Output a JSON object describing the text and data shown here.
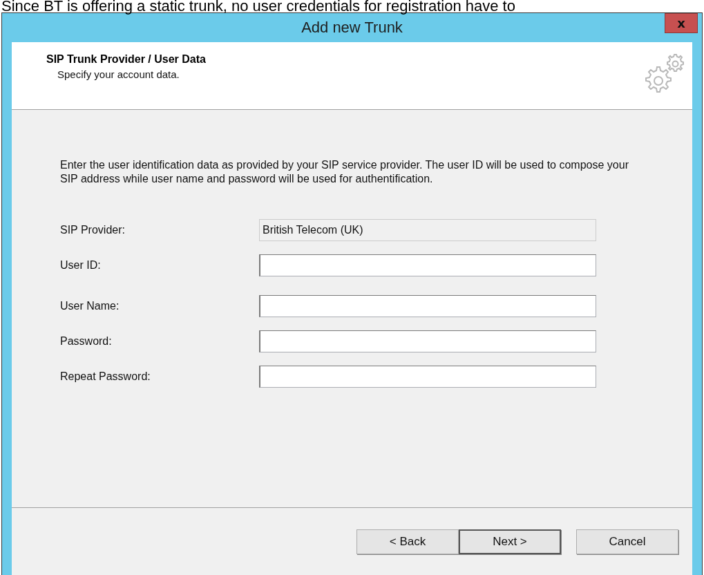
{
  "caption_above": "Since BT is offering a static trunk, no user credentials for registration have to",
  "window": {
    "title": "Add new Trunk",
    "close_label": "x"
  },
  "header": {
    "title": "SIP Trunk Provider / User Data",
    "subtitle": "Specify your account data."
  },
  "intro": "Enter the user identification data as provided by your SIP service provider. The user ID will be used to compose your SIP address while user name and password will be used for authentification.",
  "fields": [
    {
      "label": "SIP Provider:",
      "value": "British Telecom (UK)",
      "disabled": true
    },
    {
      "label": "User ID:",
      "disabled": false
    },
    {
      "label": "User Name:",
      "disabled": false
    },
    {
      "label": "Password:",
      "disabled": false
    },
    {
      "label": "Repeat Password:",
      "disabled": false
    }
  ],
  "buttons": [
    {
      "label": "< Back",
      "default": false
    },
    {
      "label": "Next >",
      "default": true
    },
    {
      "label": "Cancel",
      "default": false
    }
  ]
}
